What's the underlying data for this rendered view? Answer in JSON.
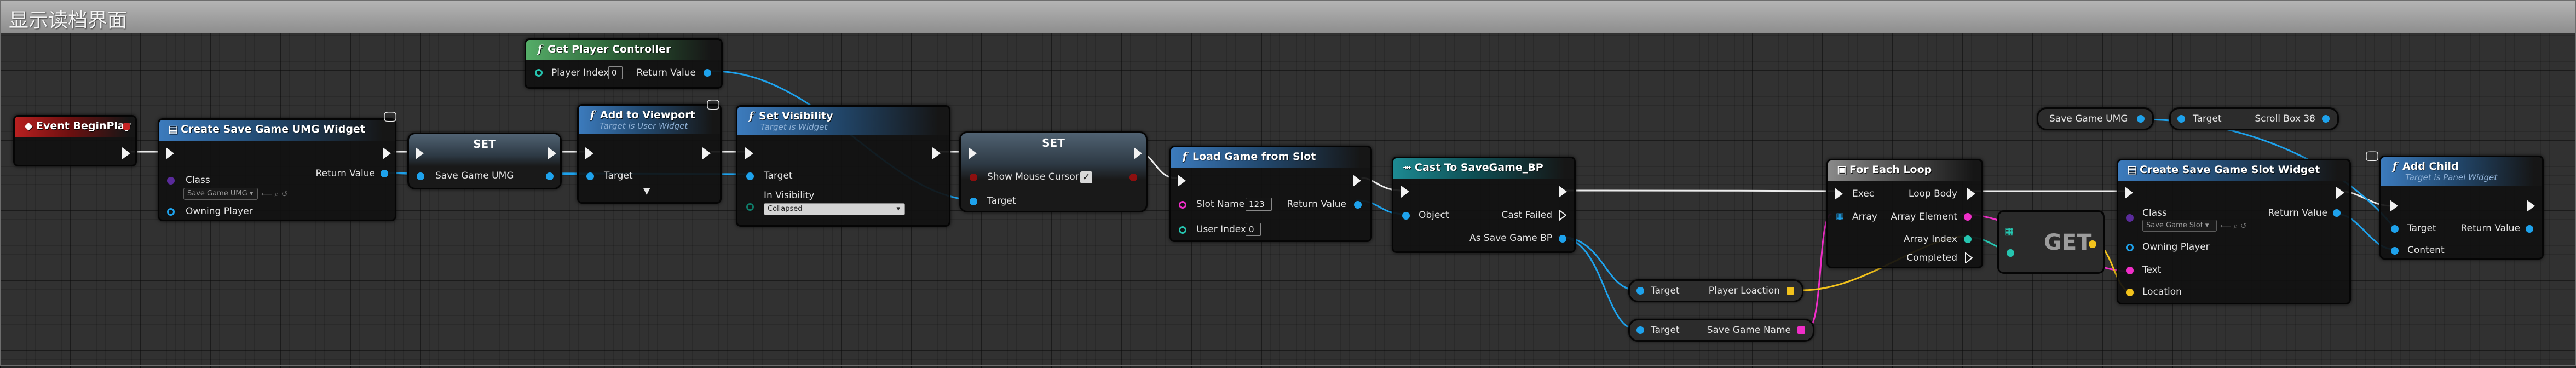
{
  "comment": {
    "title": "显示读档界面"
  },
  "nodes": {
    "event_begin_play": {
      "title": "Event BeginPlay"
    },
    "create_save_game_umg": {
      "title": "Create Save Game UMG Widget",
      "class_label": "Class",
      "class_value": "Save Game UMG",
      "owning_player_label": "Owning Player",
      "return_label": "Return Value"
    },
    "set_var_1": {
      "title": "SET",
      "pin_label": "Save Game UMG"
    },
    "get_player_controller": {
      "title": "Get Player Controller",
      "player_index_label": "Player Index",
      "player_index_value": "0",
      "return_label": "Return Value"
    },
    "add_to_viewport": {
      "title": "Add to Viewport",
      "subtitle": "Target is User Widget",
      "target_label": "Target"
    },
    "set_visibility": {
      "title": "Set Visibility",
      "subtitle": "Target is Widget",
      "target_label": "Target",
      "visibility_label": "In Visibility",
      "visibility_value": "Collapsed"
    },
    "set_var_2": {
      "title": "SET",
      "show_mouse_label": "Show Mouse Cursor",
      "show_mouse_checked": "✓",
      "target_label": "Target"
    },
    "load_game_from_slot": {
      "title": "Load Game from Slot",
      "slot_name_label": "Slot Name",
      "slot_name_value": "123",
      "user_index_label": "User Index",
      "user_index_value": "0",
      "return_label": "Return Value"
    },
    "cast_to_save_game_bp": {
      "title": "Cast To SaveGame_BP",
      "object_label": "Object",
      "cast_failed_label": "Cast Failed",
      "as_label": "As Save Game BP"
    },
    "get_player_location": {
      "target_label": "Target",
      "value_label": "Player Loaction"
    },
    "get_save_game_name": {
      "target_label": "Target",
      "value_label": "Save Game Name"
    },
    "for_each_loop": {
      "title": "For Each Loop",
      "exec_label": "Exec",
      "array_label": "Array",
      "loop_body_label": "Loop Body",
      "array_element_label": "Array Element",
      "array_index_label": "Array Index",
      "completed_label": "Completed"
    },
    "get_array": {
      "title": "GET"
    },
    "var_save_game_umg": {
      "label": "Save Game UMG"
    },
    "scroll_box": {
      "target_label": "Target",
      "value_label": "Scroll Box 38"
    },
    "create_save_game_slot": {
      "title": "Create Save Game Slot Widget",
      "class_label": "Class",
      "class_value": "Save Game Slot",
      "return_label": "Return Value",
      "owning_player_label": "Owning Player",
      "text_label": "Text",
      "location_label": "Location"
    },
    "add_child": {
      "title": "Add Child",
      "subtitle": "Target is Panel Widget",
      "target_label": "Target",
      "content_label": "Content",
      "return_label": "Return Value"
    }
  },
  "colors": {
    "exec": "#f2f2f2",
    "object_pin": "#1ea2ec",
    "string_pin": "#f02ec8",
    "vector_pin": "#f2c21c",
    "integer_pin": "#26c5b0",
    "boolean_pin": "#8c0f0f",
    "event_header": "#b82020",
    "function_header": "#3c7bbd",
    "pure_header": "#55ad68",
    "cast_header": "#1d8a92"
  }
}
